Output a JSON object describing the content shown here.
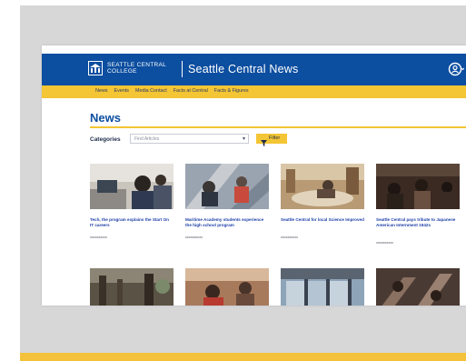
{
  "header": {
    "college_name": "SEATTLE CENTRAL\nCOLLEGE",
    "site_title": "Seattle Central News"
  },
  "nav": {
    "items": [
      "News",
      "Events",
      "Media Contact",
      "Facts at Central",
      "Facts & Figures"
    ]
  },
  "page": {
    "heading": "News",
    "categories_label": "Categories",
    "select_placeholder": "Find Articles",
    "filter_label": "Filter"
  },
  "cards": [
    {
      "title": "Tech, the program explains the Start On IT careers",
      "date": "xxxxxxxxxx"
    },
    {
      "title": "Maritime Academy students experience the high school program",
      "date": "xxxxxxxxxx"
    },
    {
      "title": "Seattle Central for local Science Improved",
      "date": "xxxxxxxxxx"
    },
    {
      "title": "Seattle Central pays tribute to Japanese American Internment 1942s",
      "date": "xxxxxxxxxx"
    },
    {
      "title": "",
      "date": ""
    },
    {
      "title": "",
      "date": ""
    },
    {
      "title": "",
      "date": ""
    },
    {
      "title": "",
      "date": ""
    }
  ],
  "colors": {
    "brand_blue": "#0c4ea0",
    "brand_gold": "#f4c534",
    "link_blue": "#1d3fa8"
  },
  "icons": {
    "logo": "college-logo-icon",
    "account": "account-icon",
    "select_arrow": "chevron-down-icon",
    "filter": "filter-icon"
  }
}
